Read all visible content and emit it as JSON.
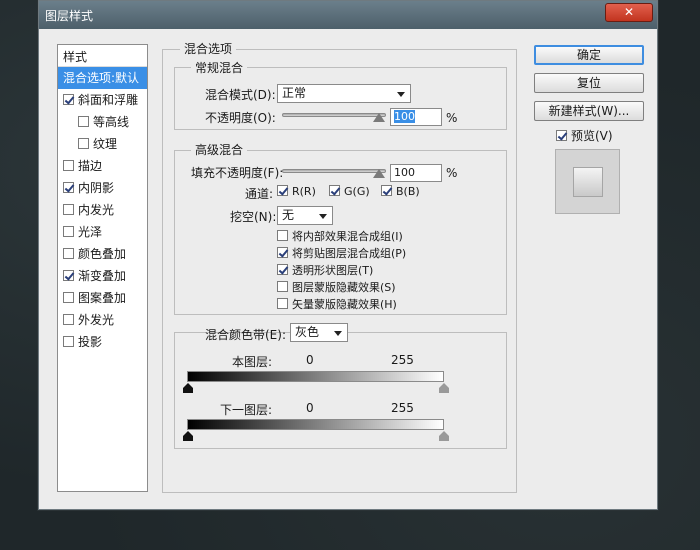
{
  "window": {
    "title": "图层样式",
    "close_glyph": "✕"
  },
  "styles_panel": {
    "header": "样式",
    "items": [
      {
        "label": "混合选项:默认",
        "checkbox": false,
        "checked": false,
        "selected": true,
        "indent": false
      },
      {
        "label": "斜面和浮雕",
        "checkbox": true,
        "checked": true,
        "selected": false,
        "indent": false
      },
      {
        "label": "等高线",
        "checkbox": true,
        "checked": false,
        "selected": false,
        "indent": true
      },
      {
        "label": "纹理",
        "checkbox": true,
        "checked": false,
        "selected": false,
        "indent": true
      },
      {
        "label": "描边",
        "checkbox": true,
        "checked": false,
        "selected": false,
        "indent": false
      },
      {
        "label": "内阴影",
        "checkbox": true,
        "checked": true,
        "selected": false,
        "indent": false
      },
      {
        "label": "内发光",
        "checkbox": true,
        "checked": false,
        "selected": false,
        "indent": false
      },
      {
        "label": "光泽",
        "checkbox": true,
        "checked": false,
        "selected": false,
        "indent": false
      },
      {
        "label": "颜色叠加",
        "checkbox": true,
        "checked": false,
        "selected": false,
        "indent": false
      },
      {
        "label": "渐变叠加",
        "checkbox": true,
        "checked": true,
        "selected": false,
        "indent": false
      },
      {
        "label": "图案叠加",
        "checkbox": true,
        "checked": false,
        "selected": false,
        "indent": false
      },
      {
        "label": "外发光",
        "checkbox": true,
        "checked": false,
        "selected": false,
        "indent": false
      },
      {
        "label": "投影",
        "checkbox": true,
        "checked": false,
        "selected": false,
        "indent": false
      }
    ]
  },
  "blend_options": {
    "title": "混合选项",
    "general": {
      "title": "常规混合",
      "mode_label": "混合模式(D):",
      "mode_value": "正常",
      "opacity_label": "不透明度(O):",
      "opacity_value": "100",
      "unit": "%"
    },
    "advanced": {
      "title": "高级混合",
      "fill_label": "填充不透明度(F):",
      "fill_value": "100",
      "unit": "%",
      "channels_label": "通道:",
      "channels": [
        {
          "label": "R(R)",
          "checked": true
        },
        {
          "label": "G(G)",
          "checked": true
        },
        {
          "label": "B(B)",
          "checked": true
        }
      ],
      "knockout_label": "挖空(N):",
      "knockout_value": "无",
      "options": [
        {
          "label": "将内部效果混合成组(I)",
          "checked": false
        },
        {
          "label": "将剪贴图层混合成组(P)",
          "checked": true
        },
        {
          "label": "透明形状图层(T)",
          "checked": true
        },
        {
          "label": "图层蒙版隐藏效果(S)",
          "checked": false
        },
        {
          "label": "矢量蒙版隐藏效果(H)",
          "checked": false
        }
      ]
    },
    "blend_if": {
      "label": "混合颜色带(E):",
      "value": "灰色",
      "this_layer_label": "本图层:",
      "this_layer_min": "0",
      "this_layer_max": "255",
      "underlying_label": "下一图层:",
      "underlying_min": "0",
      "underlying_max": "255"
    }
  },
  "buttons": {
    "ok": "确定",
    "cancel": "复位",
    "new_style": "新建样式(W)...",
    "preview_label": "预览(V)",
    "preview_checked": true
  },
  "colors": {
    "accent": "#3a8fe6",
    "titlebar": "#56697a",
    "close": "#c9402a"
  },
  "icons": {
    "close": "close-icon",
    "dropdown": "chevron-down-icon",
    "check": "checkmark-icon",
    "slider": "slider-thumb-icon",
    "stop": "gradient-stop-icon"
  }
}
